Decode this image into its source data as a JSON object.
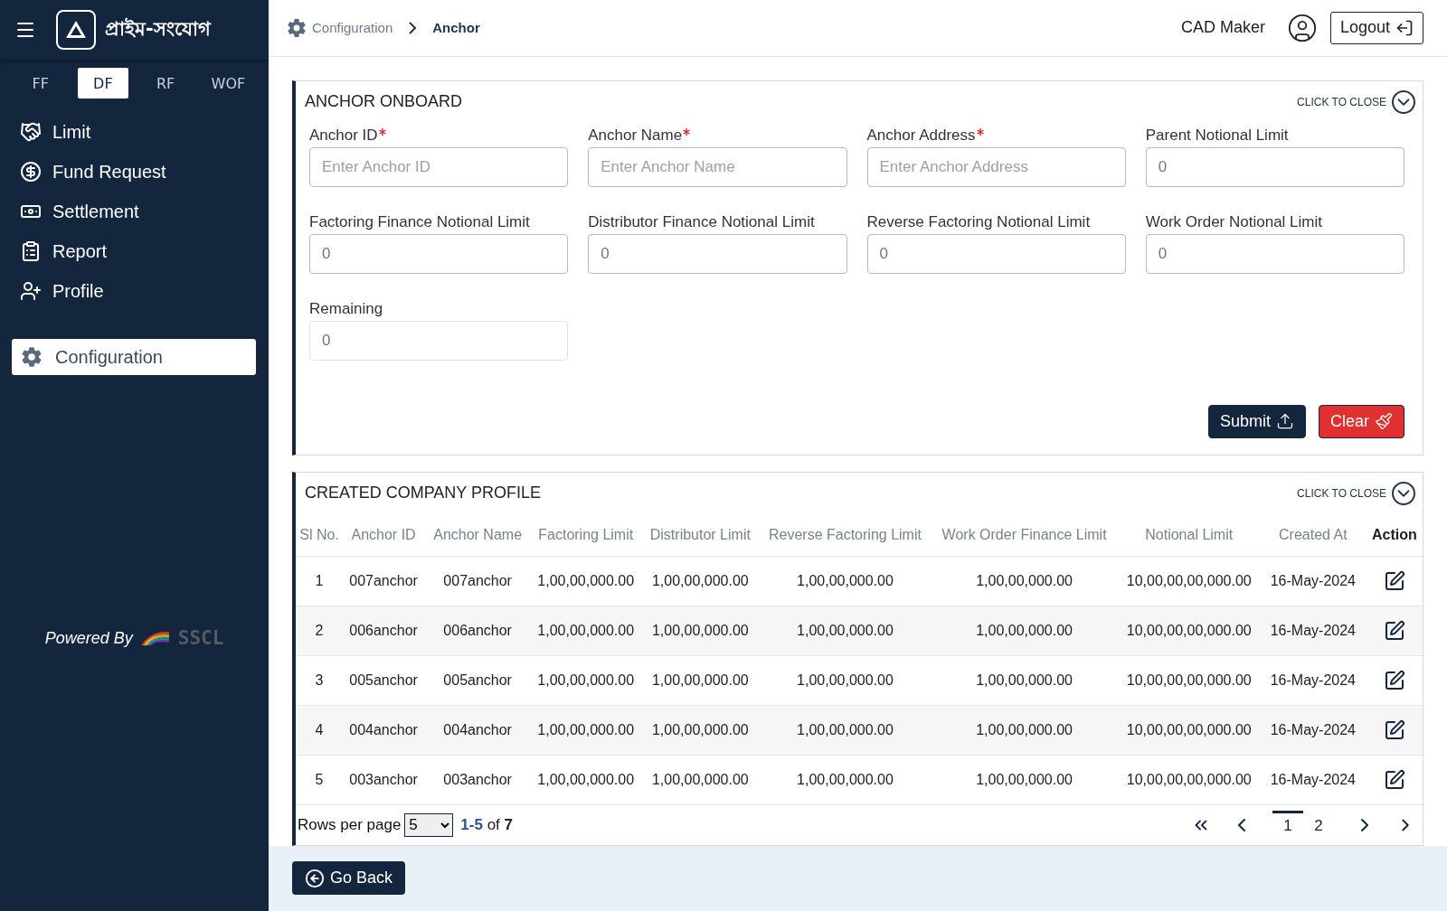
{
  "sidebar": {
    "brand": "প্রাইম-সংযোগ",
    "tabs": [
      {
        "label": "FF",
        "selected": false
      },
      {
        "label": "DF",
        "selected": true
      },
      {
        "label": "RF",
        "selected": false
      },
      {
        "label": "WOF",
        "selected": false
      }
    ],
    "menu": [
      {
        "label": "Limit",
        "selected": false
      },
      {
        "label": "Fund Request",
        "selected": false
      },
      {
        "label": "Settlement",
        "selected": false
      },
      {
        "label": "Report",
        "selected": false
      },
      {
        "label": "Profile",
        "selected": false
      }
    ],
    "config": {
      "label": "Configuration",
      "selected": true
    },
    "powered_by": "Powered By",
    "powered_logo": "SSCL"
  },
  "header": {
    "breadcrumb": [
      "Configuration",
      "Anchor"
    ],
    "user": "CAD Maker",
    "logout": "Logout"
  },
  "form": {
    "title": "ANCHOR ONBOARD",
    "close_label": "CLICK TO CLOSE",
    "fields": [
      {
        "label": "Anchor ID",
        "required": true,
        "placeholder": "Enter Anchor ID",
        "disabled": false
      },
      {
        "label": "Anchor Name",
        "required": true,
        "placeholder": "Enter Anchor Name",
        "disabled": false
      },
      {
        "label": "Anchor Address",
        "required": true,
        "placeholder": "Enter Anchor Address",
        "disabled": false
      },
      {
        "label": "Parent Notional Limit",
        "required": false,
        "value": "0",
        "disabled": false
      },
      {
        "label": "Factoring Finance Notional Limit",
        "required": false,
        "value": "0",
        "disabled": false
      },
      {
        "label": "Distributor Finance Notional Limit",
        "required": false,
        "value": "0",
        "disabled": false
      },
      {
        "label": "Reverse Factoring Notional Limit",
        "required": false,
        "value": "0",
        "disabled": false
      },
      {
        "label": "Work Order Notional Limit",
        "required": false,
        "value": "0",
        "disabled": false
      },
      {
        "label": "Remaining",
        "required": false,
        "value": "0",
        "disabled": true
      }
    ],
    "submit": "Submit",
    "clear": "Clear"
  },
  "table": {
    "title": "CREATED COMPANY PROFILE",
    "close_label": "CLICK TO CLOSE",
    "columns": [
      {
        "label": "Sl No.",
        "bold": false
      },
      {
        "label": "Anchor ID",
        "bold": false
      },
      {
        "label": "Anchor Name",
        "bold": false
      },
      {
        "label": "Factoring Limit",
        "bold": false
      },
      {
        "label": "Distributor Limit",
        "bold": false
      },
      {
        "label": "Reverse Factoring Limit",
        "bold": false
      },
      {
        "label": "Work Order Finance Limit",
        "bold": false
      },
      {
        "label": "Notional Limit",
        "bold": false
      },
      {
        "label": "Created At",
        "bold": false
      },
      {
        "label": "Action",
        "bold": true
      }
    ],
    "rows": [
      [
        "1",
        "007anchor",
        "007anchor",
        "1,00,00,000.00",
        "1,00,00,000.00",
        "1,00,00,000.00",
        "1,00,00,000.00",
        "10,00,00,00,000.00",
        "16-May-2024"
      ],
      [
        "2",
        "006anchor",
        "006anchor",
        "1,00,00,000.00",
        "1,00,00,000.00",
        "1,00,00,000.00",
        "1,00,00,000.00",
        "10,00,00,00,000.00",
        "16-May-2024"
      ],
      [
        "3",
        "005anchor",
        "005anchor",
        "1,00,00,000.00",
        "1,00,00,000.00",
        "1,00,00,000.00",
        "1,00,00,000.00",
        "10,00,00,00,000.00",
        "16-May-2024"
      ],
      [
        "4",
        "004anchor",
        "004anchor",
        "1,00,00,000.00",
        "1,00,00,000.00",
        "1,00,00,000.00",
        "1,00,00,000.00",
        "10,00,00,00,000.00",
        "16-May-2024"
      ],
      [
        "5",
        "003anchor",
        "003anchor",
        "1,00,00,000.00",
        "1,00,00,000.00",
        "1,00,00,000.00",
        "1,00,00,000.00",
        "10,00,00,00,000.00",
        "16-May-2024"
      ]
    ],
    "rows_per_page_label": "Rows per page",
    "rows_per_page": "5",
    "range_text": "**1-5** of **7**",
    "pages": [
      {
        "label": "1",
        "selected": true
      },
      {
        "label": "2",
        "selected": false
      }
    ]
  },
  "go_back": "Go Back"
}
